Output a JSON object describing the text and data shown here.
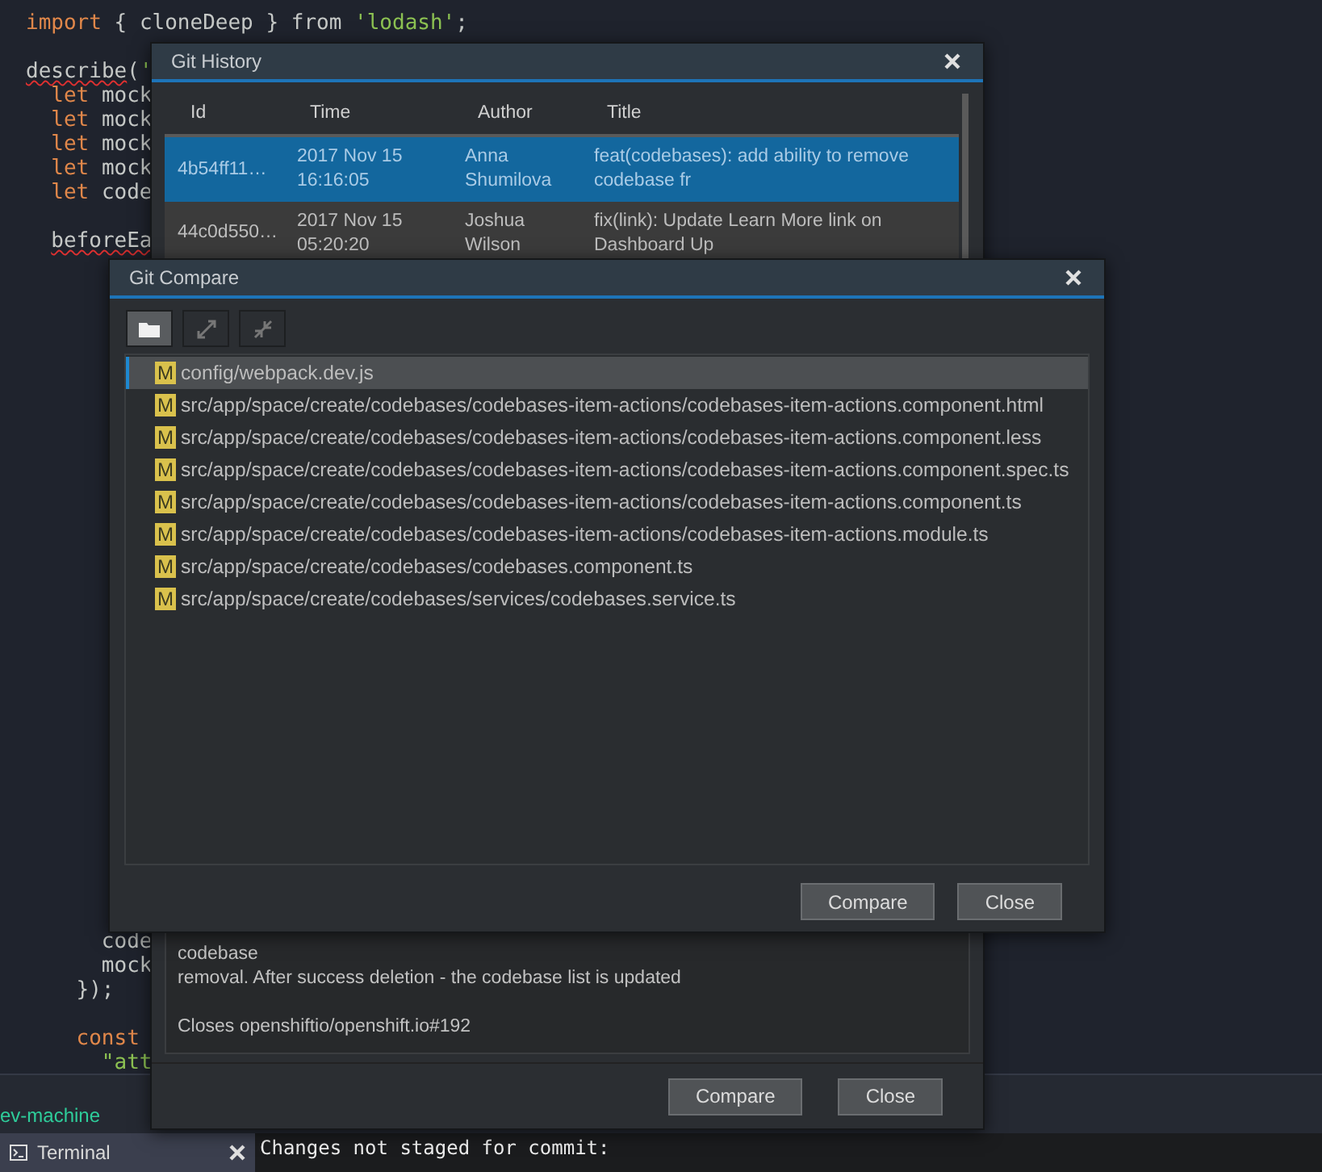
{
  "editor": {
    "top_lines": [
      {
        "segments": [
          {
            "kind": "keyword",
            "text": "import"
          },
          {
            "kind": "plain",
            "text": " { cloneDeep } from "
          },
          {
            "kind": "string",
            "text": "'lodash'"
          },
          {
            "kind": "plain",
            "text": ";"
          }
        ]
      },
      {
        "blank_before": true,
        "segments": [
          {
            "kind": "error",
            "text": "describe"
          },
          {
            "kind": "plain",
            "text": "("
          },
          {
            "kind": "string",
            "text": "'"
          }
        ],
        "children": [
          {
            "segments": [
              {
                "kind": "keyword",
                "text": "let"
              },
              {
                "kind": "plain",
                "text": " mock"
              }
            ]
          },
          {
            "segments": [
              {
                "kind": "keyword",
                "text": "let"
              },
              {
                "kind": "plain",
                "text": " mock"
              }
            ]
          },
          {
            "segments": [
              {
                "kind": "keyword",
                "text": "let"
              },
              {
                "kind": "plain",
                "text": " mock"
              }
            ]
          },
          {
            "segments": [
              {
                "kind": "keyword",
                "text": "let"
              },
              {
                "kind": "plain",
                "text": " mock"
              }
            ]
          },
          {
            "segments": [
              {
                "kind": "keyword",
                "text": "let"
              },
              {
                "kind": "plain",
                "text": " code"
              }
            ]
          },
          {
            "blank_before": true,
            "segments": [
              {
                "kind": "error",
                "text": "beforeEa"
              }
            ]
          }
        ]
      }
    ],
    "bottom_lines": [
      {
        "children": [
          {
            "children": [
              {
                "children": [
                  {
                    "segments": [
                      {
                        "kind": "plain",
                        "text": "code"
                      }
                    ]
                  },
                  {
                    "segments": [
                      {
                        "kind": "plain",
                        "text": "mock"
                      }
                    ]
                  }
                ]
              },
              {
                "segments": [
                  {
                    "kind": "plain",
                    "text": "});"
                  }
                ]
              },
              {
                "blank_before": true,
                "segments": [
                  {
                    "kind": "keyword",
                    "text": "const"
                  }
                ],
                "children": [
                  {
                    "segments": [
                      {
                        "kind": "string",
                        "text": "\"att"
                      }
                    ]
                  }
                ]
              }
            ]
          }
        ]
      }
    ]
  },
  "panel": {
    "label": "ev-machine"
  },
  "terminal": {
    "tab": "Terminal",
    "lines": [
      "Changes not staged for commit:"
    ]
  },
  "git_history": {
    "title": "Git History",
    "columns": [
      "Id",
      "Time",
      "Author",
      "Title"
    ],
    "rows": [
      {
        "id": "4b54ff11…",
        "time": "2017 Nov 15 16:16:05",
        "author": "Anna Shumilova",
        "title": "feat(codebases): add ability to remove codebase fr",
        "selected": true
      },
      {
        "id": "44c0d550…",
        "time": "2017 Nov 15 05:20:20",
        "author": "Joshua Wilson",
        "title": "fix(link): Update Learn More link on Dashboard Up",
        "selected": false
      }
    ],
    "message": {
      "lines": [
        "codebase",
        "removal. After success deletion - the codebase list is updated"
      ],
      "footer": "Closes openshiftio/openshift.io#192"
    },
    "buttons": [
      "Compare",
      "Close"
    ]
  },
  "git_compare": {
    "title": "Git Compare",
    "toolbar": [
      {
        "kind": "folder",
        "selected": true
      },
      {
        "kind": "expand",
        "selected": false
      },
      {
        "kind": "collapse",
        "selected": false
      }
    ],
    "files": [
      {
        "status": "M",
        "path": "config/webpack.dev.js",
        "selected": true
      },
      {
        "status": "M",
        "path": "src/app/space/create/codebases/codebases-item-actions/codebases-item-actions.component.html",
        "selected": false
      },
      {
        "status": "M",
        "path": "src/app/space/create/codebases/codebases-item-actions/codebases-item-actions.component.less",
        "selected": false
      },
      {
        "status": "M",
        "path": "src/app/space/create/codebases/codebases-item-actions/codebases-item-actions.component.spec.ts",
        "selected": false
      },
      {
        "status": "M",
        "path": "src/app/space/create/codebases/codebases-item-actions/codebases-item-actions.component.ts",
        "selected": false
      },
      {
        "status": "M",
        "path": "src/app/space/create/codebases/codebases-item-actions/codebases-item-actions.module.ts",
        "selected": false
      },
      {
        "status": "M",
        "path": "src/app/space/create/codebases/codebases.component.ts",
        "selected": false
      },
      {
        "status": "M",
        "path": "src/app/space/create/codebases/services/codebases.service.ts",
        "selected": false
      }
    ],
    "buttons": [
      "Compare",
      "Close"
    ]
  }
}
